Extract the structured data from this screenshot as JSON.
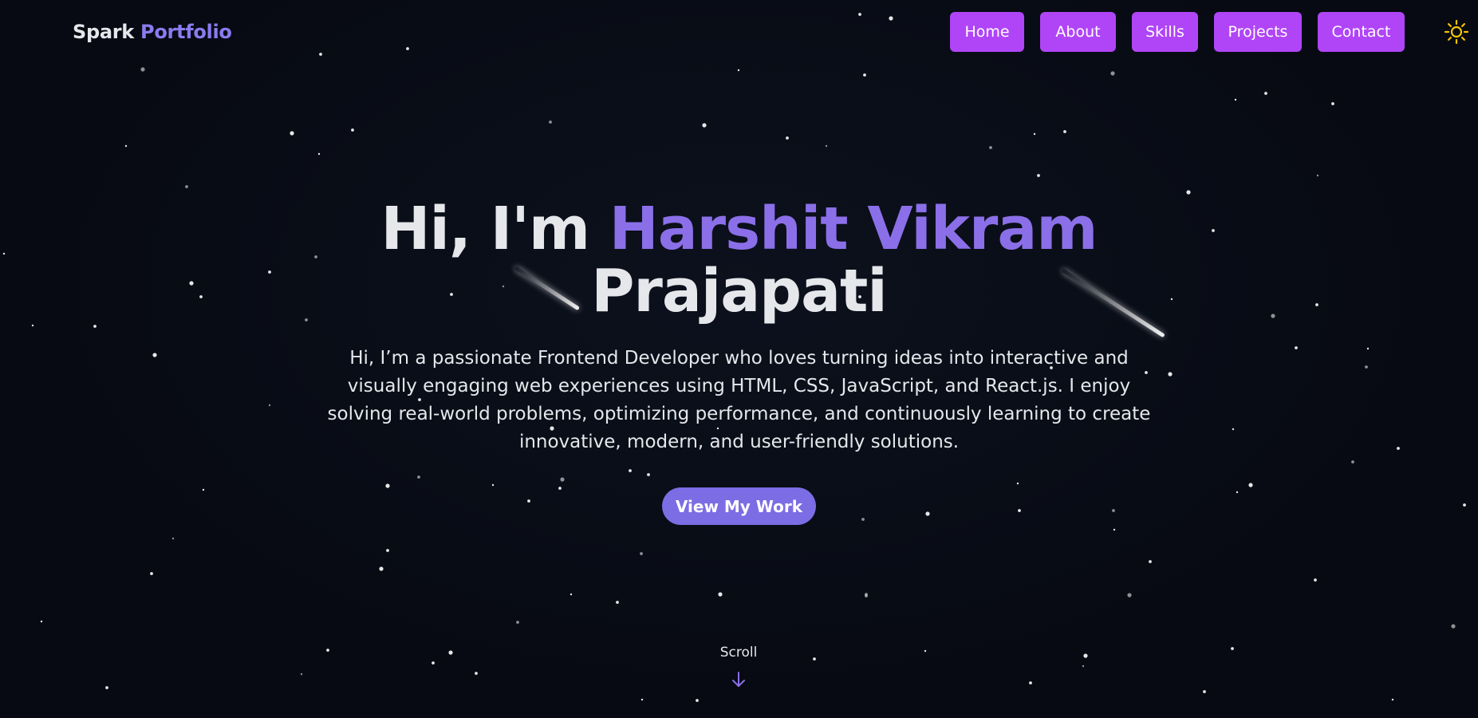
{
  "brand": {
    "first": "Spark",
    "second": "Portfolio"
  },
  "nav": {
    "items": [
      {
        "label": "Home"
      },
      {
        "label": "About"
      },
      {
        "label": "Skills"
      },
      {
        "label": "Projects"
      },
      {
        "label": "Contact"
      }
    ],
    "button_color": "#b045f7"
  },
  "theme_toggle": {
    "icon": "sun-icon",
    "color": "#f5c400"
  },
  "hero": {
    "greeting": "Hi, I'm ",
    "name_highlight": "Harshit Vikram",
    "name_rest": "Prajapati",
    "description": "Hi, I’m a passionate Frontend Developer who loves turning ideas into interactive and visually engaging web experiences using HTML, CSS, JavaScript, and React.js. I enjoy solving real-world problems, optimizing performance, and continuously learning to create innovative, modern, and user-friendly solutions.",
    "cta_label": "View My Work",
    "accent_color": "#8b6fe8"
  },
  "scroll": {
    "label": "Scroll",
    "icon": "arrow-down-icon"
  },
  "colors": {
    "background": "#070a12",
    "text": "#e5e7eb",
    "cta": "#7c6de4"
  }
}
